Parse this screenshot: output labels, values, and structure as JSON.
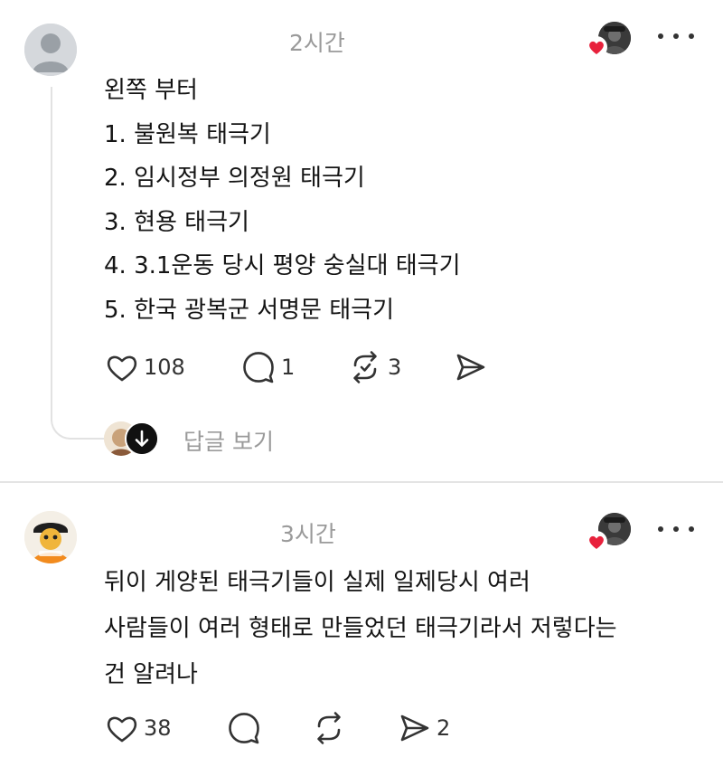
{
  "posts": [
    {
      "time": "2시간",
      "lines": [
        "왼쪽 부터",
        "1. 불원복 태극기",
        "2. 임시정부 의정원 태극기",
        "3. 현용 태극기",
        "4. 3.1운동 당시 평양 숭실대 태극기",
        "5. 한국 광복군 서명문 태극기"
      ],
      "likes": "108",
      "comments": "1",
      "reposts": "3",
      "shares": "",
      "view_replies": "답글 보기"
    },
    {
      "time": "3시간",
      "lines": [
        "뒤이 게양된 태극기들이 실제 일제당시 여러",
        "사람들이 여러 형태로 만들었던 태극기라서 저렇다는",
        "건 알려나"
      ],
      "likes": "38",
      "comments": "",
      "reposts": "",
      "shares": "2"
    }
  ],
  "icons": [
    "heart-icon",
    "comment-icon",
    "repost-icon",
    "share-icon",
    "more-icon",
    "arrow-down-icon"
  ],
  "colors": {
    "like_red": "#e8213c",
    "muted_text": "#9a9a9a",
    "divider": "#e4e4e4"
  }
}
